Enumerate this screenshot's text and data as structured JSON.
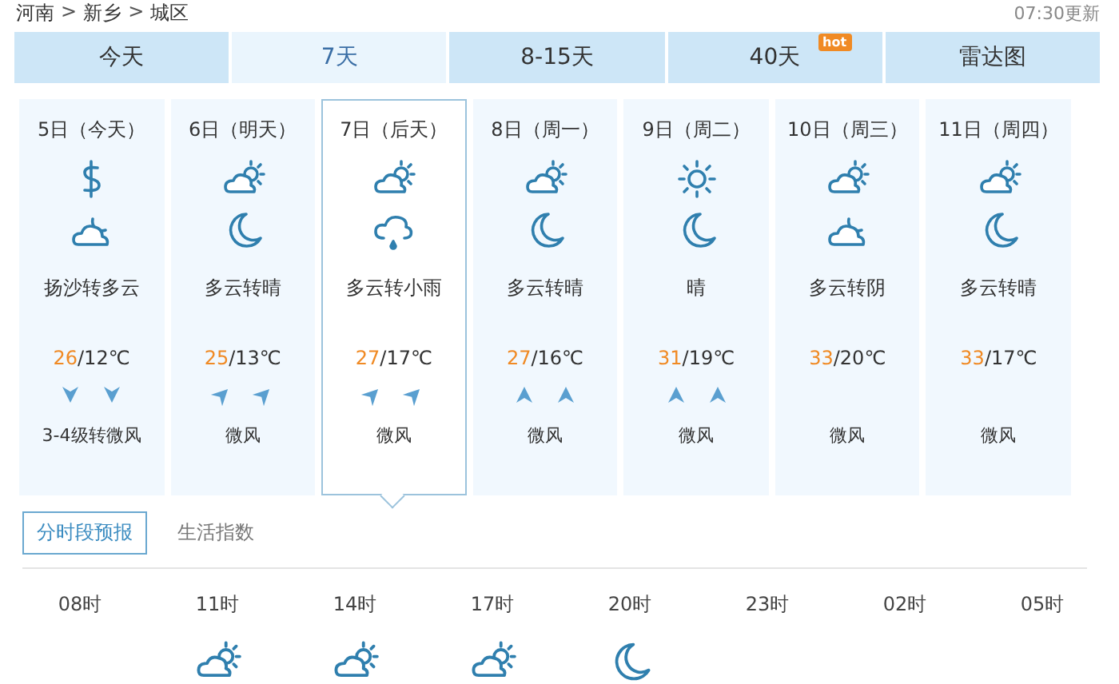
{
  "breadcrumb": [
    {
      "label": "河南"
    },
    {
      "label": "新乡"
    },
    {
      "label": "城区"
    }
  ],
  "breadcrumb_separator": ">",
  "update_time": "07:30更新",
  "tabs": [
    {
      "label": "今天",
      "selected": false
    },
    {
      "label": "7天",
      "selected": true
    },
    {
      "label": "8-15天",
      "selected": false
    },
    {
      "label": "40天",
      "selected": false,
      "badge": "hot"
    },
    {
      "label": "雷达图",
      "selected": false
    }
  ],
  "days": [
    {
      "date": "5日（今天）",
      "icons": [
        {
          "kind": "dust"
        },
        {
          "kind": "cloudy-night"
        }
      ],
      "weather": "扬沙转多云",
      "high": "26",
      "low": "/12℃",
      "wind_arrows": [
        {
          "kind": "south"
        },
        {
          "kind": "south"
        }
      ],
      "wind": "3-4级转微风",
      "selected": false
    },
    {
      "date": "6日（明天）",
      "icons": [
        {
          "kind": "partly-cloudy"
        },
        {
          "kind": "moon"
        }
      ],
      "weather": "多云转晴",
      "high": "25",
      "low": "/13℃",
      "wind_arrows": [
        {
          "kind": "northeast"
        },
        {
          "kind": "northeast"
        }
      ],
      "wind": "微风",
      "selected": false
    },
    {
      "date": "7日（后天）",
      "icons": [
        {
          "kind": "partly-cloudy"
        },
        {
          "kind": "rain"
        }
      ],
      "weather": "多云转小雨",
      "high": "27",
      "low": "/17℃",
      "wind_arrows": [
        {
          "kind": "northeast"
        },
        {
          "kind": "northeast"
        }
      ],
      "wind": "微风",
      "selected": true
    },
    {
      "date": "8日（周一）",
      "icons": [
        {
          "kind": "partly-cloudy"
        },
        {
          "kind": "moon"
        }
      ],
      "weather": "多云转晴",
      "high": "27",
      "low": "/16℃",
      "wind_arrows": [
        {
          "kind": "north"
        },
        {
          "kind": "north"
        }
      ],
      "wind": "微风",
      "selected": false
    },
    {
      "date": "9日（周二）",
      "icons": [
        {
          "kind": "sun"
        },
        {
          "kind": "moon"
        }
      ],
      "weather": "晴",
      "high": "31",
      "low": "/19℃",
      "wind_arrows": [
        {
          "kind": "north"
        },
        {
          "kind": "north"
        }
      ],
      "wind": "微风",
      "selected": false
    },
    {
      "date": "10日（周三）",
      "icons": [
        {
          "kind": "partly-cloudy"
        },
        {
          "kind": "cloudy-night"
        }
      ],
      "weather": "多云转阴",
      "high": "33",
      "low": "/20℃",
      "wind": "微风",
      "selected": false
    },
    {
      "date": "11日（周四）",
      "icons": [
        {
          "kind": "partly-cloudy"
        },
        {
          "kind": "moon"
        }
      ],
      "weather": "多云转晴",
      "high": "33",
      "low": "/17℃",
      "wind": "微风",
      "selected": false
    }
  ],
  "sub_tabs": [
    {
      "label": "分时段预报",
      "selected": true
    },
    {
      "label": "生活指数",
      "selected": false
    }
  ],
  "hourly": [
    {
      "time": "08时"
    },
    {
      "time": "11时",
      "icons": [
        {
          "kind": "partly-cloudy"
        }
      ]
    },
    {
      "time": "14时",
      "icons": [
        {
          "kind": "partly-cloudy"
        }
      ]
    },
    {
      "time": "17时",
      "icons": [
        {
          "kind": "partly-cloudy"
        }
      ]
    },
    {
      "time": "20时",
      "icons": [
        {
          "kind": "moon"
        }
      ]
    },
    {
      "time": "23时"
    },
    {
      "time": "02时"
    },
    {
      "time": "05时"
    }
  ]
}
